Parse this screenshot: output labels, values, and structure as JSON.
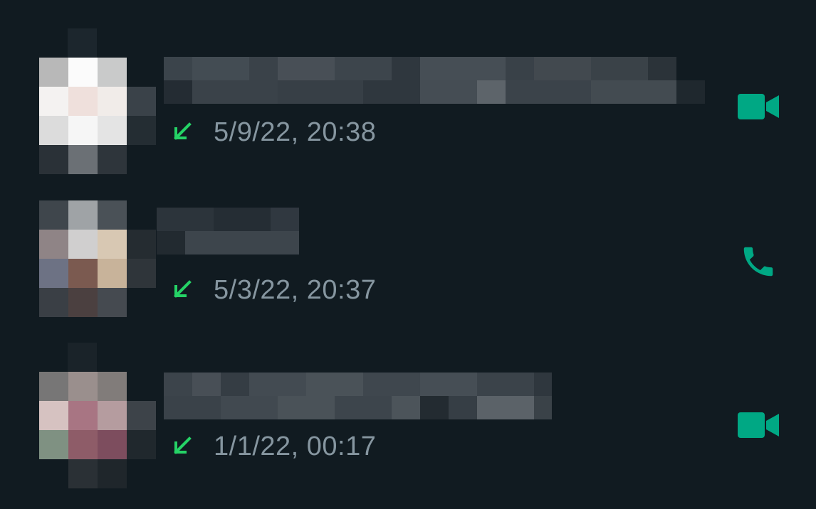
{
  "colors": {
    "background": "#111b21",
    "accent": "#00a884",
    "incoming_arrow": "#25d366",
    "timestamp": "#8696a0"
  },
  "calls": [
    {
      "timestamp": "5/9/22, 20:38",
      "direction_icon": "incoming-arrow-icon",
      "call_type": "video",
      "action_icon": "video-camera-icon"
    },
    {
      "timestamp": "5/3/22, 20:37",
      "direction_icon": "incoming-arrow-icon",
      "call_type": "voice",
      "action_icon": "phone-icon"
    },
    {
      "timestamp": "1/1/22, 00:17",
      "direction_icon": "incoming-arrow-icon",
      "call_type": "video",
      "action_icon": "video-camera-icon"
    }
  ]
}
